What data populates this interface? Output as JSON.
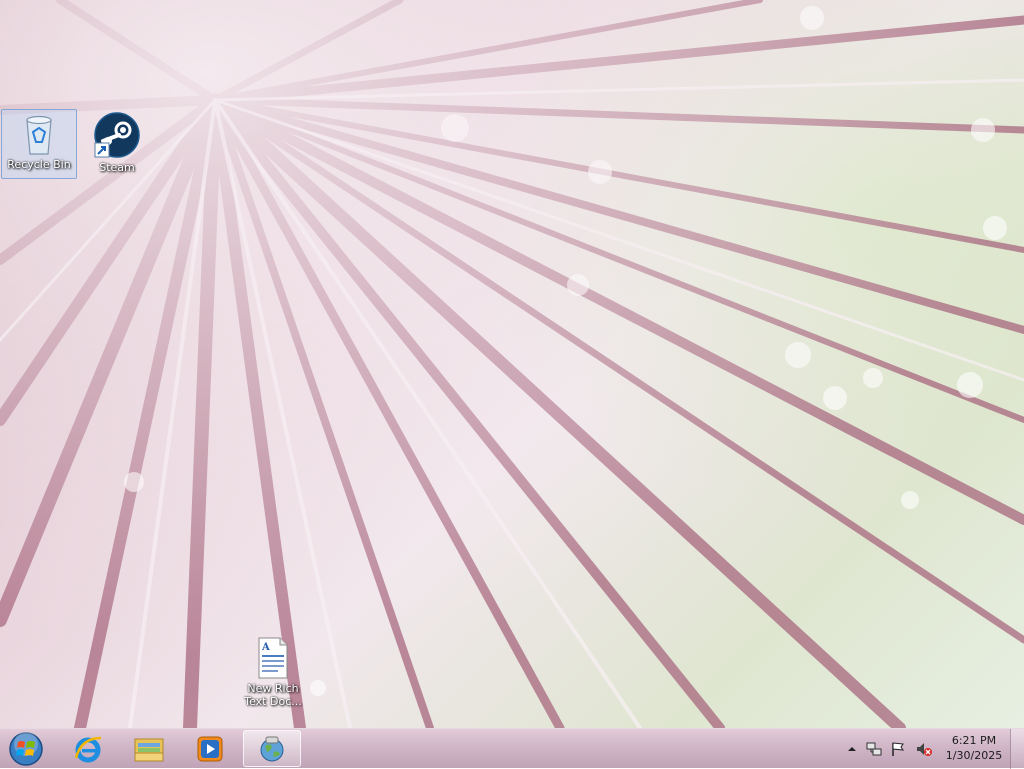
{
  "desktop": {
    "icons": [
      {
        "label": "Recycle Bin",
        "icon": "recycle-bin-icon",
        "selected": true
      },
      {
        "label": "Steam",
        "icon": "steam-icon",
        "selected": false
      },
      {
        "label": "New Rich\nText Doc...",
        "icon": "rich-text-document-icon",
        "selected": false
      }
    ]
  },
  "taskbar": {
    "start": {
      "icon": "windows-start-orb-icon"
    },
    "pinned": [
      {
        "name": "Internet Explorer",
        "icon": "internet-explorer-icon"
      },
      {
        "name": "Windows Explorer",
        "icon": "folder-library-icon"
      },
      {
        "name": "Windows Media Player",
        "icon": "media-player-icon"
      },
      {
        "name": "Network Connection",
        "icon": "network-globe-icon",
        "active": true
      }
    ],
    "tray": {
      "icons": [
        "show-hidden-icons-arrow",
        "network-icon",
        "action-center-flag-icon",
        "volume-muted-icon"
      ],
      "time": "6:21 PM",
      "date": "1/30/2025"
    }
  },
  "colors": {
    "taskbar": "#cdb2c4",
    "wallpaper_strand": "#a8687f",
    "wallpaper_light": "#f1e7ec",
    "icon_label": "#ffffff"
  }
}
